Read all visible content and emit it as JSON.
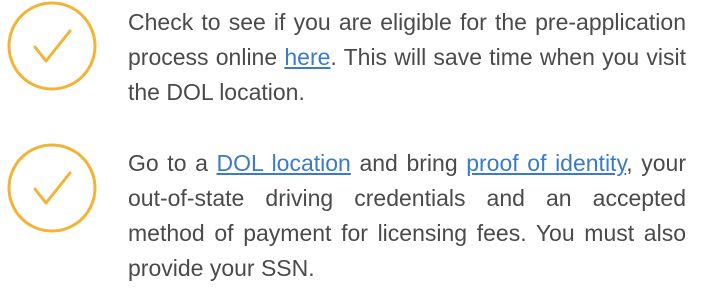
{
  "accent_color": "#f5b335",
  "link_color": "#3a7ac9",
  "steps": [
    {
      "icon": "checkmark-circle-icon",
      "text_before": "Check to see if you are eligible for the pre-application process online ",
      "link_here": "here",
      "text_after": ". This will save time when you visit the DOL location."
    },
    {
      "icon": "checkmark-circle-icon",
      "text_a": "Go to a ",
      "link_dol_location": "DOL location",
      "text_b": " and bring ",
      "link_proof_of_identity": "proof of identity",
      "text_c": ", your out-of-state driving credentials and an accepted method of payment for licensing fees. You must also provide your SSN."
    }
  ]
}
